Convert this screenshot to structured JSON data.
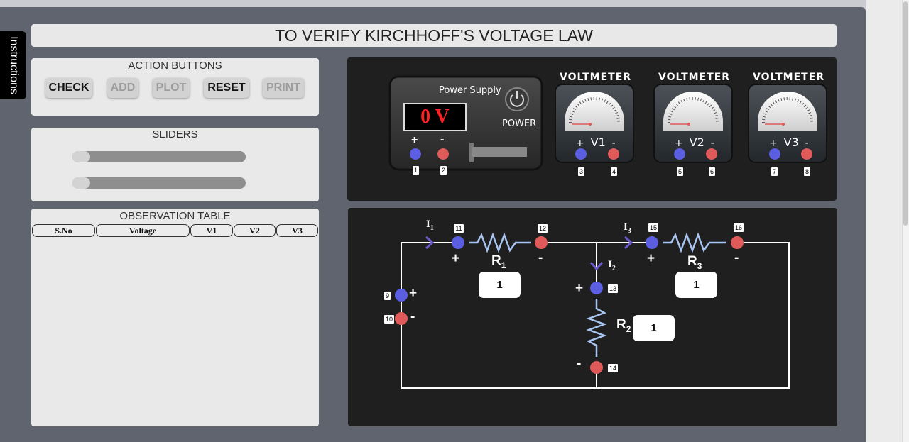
{
  "instructions_tab": {
    "label": "Instructions"
  },
  "title": "TO VERIFY KIRCHHOFF'S VOLTAGE LAW",
  "action_buttons": {
    "title": "ACTION BUTTONS",
    "check": "CHECK",
    "add": "ADD",
    "plot": "PLOT",
    "reset": "RESET",
    "print": "PRINT"
  },
  "sliders": {
    "title": "SLIDERS"
  },
  "observation_table": {
    "title": "OBSERVATION TABLE",
    "columns": [
      "S.No",
      "Voltage",
      "V1",
      "V2",
      "V3"
    ],
    "rows": []
  },
  "power_supply": {
    "title": "Power Supply",
    "display": "0 V",
    "power_label": "POWER",
    "plus": "+",
    "minus": "-",
    "terminals": [
      "1",
      "2"
    ]
  },
  "voltmeters": [
    {
      "title": "VOLTMETER",
      "label": "V1",
      "terminals": [
        "3",
        "4"
      ]
    },
    {
      "title": "VOLTMETER",
      "label": "V2",
      "terminals": [
        "5",
        "6"
      ]
    },
    {
      "title": "VOLTMETER",
      "label": "V3",
      "terminals": [
        "7",
        "8"
      ]
    }
  ],
  "circuit": {
    "i1": "I",
    "i1_sub": "1",
    "i2": "I",
    "i2_sub": "2",
    "i3": "I",
    "i3_sub": "3",
    "r1": "R",
    "r1_sub": "1",
    "r2": "R",
    "r2_sub": "2",
    "r3": "R",
    "r3_sub": "3",
    "r1_value": "1",
    "r2_value": "1",
    "r3_value": "1",
    "plus": "+",
    "minus": "-",
    "nodes": [
      "9",
      "10",
      "11",
      "12",
      "13",
      "14",
      "15",
      "16"
    ]
  },
  "colors": {
    "positive": "#5b5ee0",
    "negative": "#e05a5a",
    "wire": "#ffffff",
    "resistor": "#a8c4f0",
    "arrow": "#6a5acd",
    "display_text": "#ff2020"
  }
}
